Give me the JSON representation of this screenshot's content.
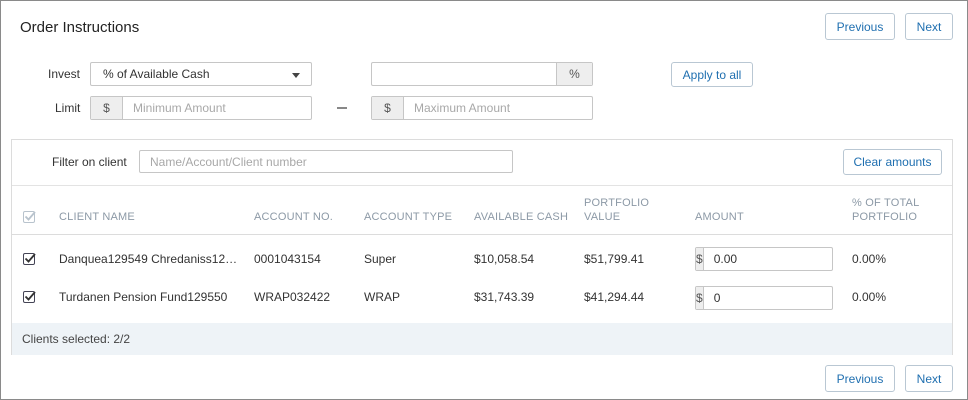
{
  "header": {
    "title": "Order Instructions",
    "previous_label": "Previous",
    "next_label": "Next"
  },
  "invest": {
    "label": "Invest",
    "selected": "% of Available Cash",
    "percent_value": "",
    "percent_symbol": "%",
    "apply_label": "Apply to all"
  },
  "limit": {
    "label": "Limit",
    "currency_symbol": "$",
    "min_placeholder": "Minimum Amount",
    "max_placeholder": "Maximum Amount"
  },
  "filter": {
    "label": "Filter on client",
    "placeholder": "Name/Account/Client number",
    "clear_label": "Clear amounts"
  },
  "table": {
    "columns": {
      "client_name": "CLIENT NAME",
      "account_no": "ACCOUNT NO.",
      "account_type": "ACCOUNT TYPE",
      "available_cash": "AVAILABLE CASH",
      "portfolio_value_1": "PORTFOLIO",
      "portfolio_value_2": "VALUE",
      "amount": "AMOUNT",
      "pct_1": "% OF TOTAL",
      "pct_2": "PORTFOLIO"
    },
    "rows": [
      {
        "checked": true,
        "client_name": "Danquea129549 Chredaniss12…",
        "account_no": "0001043154",
        "account_type": "Super",
        "available_cash": "$10,058.54",
        "portfolio_value": "$51,799.41",
        "currency": "$",
        "amount": "0.00",
        "pct": "0.00%"
      },
      {
        "checked": true,
        "client_name": "Turdanen Pension Fund129550",
        "account_no": "WRAP032422",
        "account_type": "WRAP",
        "available_cash": "$31,743.39",
        "portfolio_value": "$41,294.44",
        "currency": "$",
        "amount": "0",
        "pct": "0.00%"
      }
    ],
    "footer": "Clients selected: 2/2"
  },
  "colors": {
    "accent": "#1f6fb0",
    "footer_bg": "#eef3f7",
    "header_text": "#8c99a6"
  }
}
